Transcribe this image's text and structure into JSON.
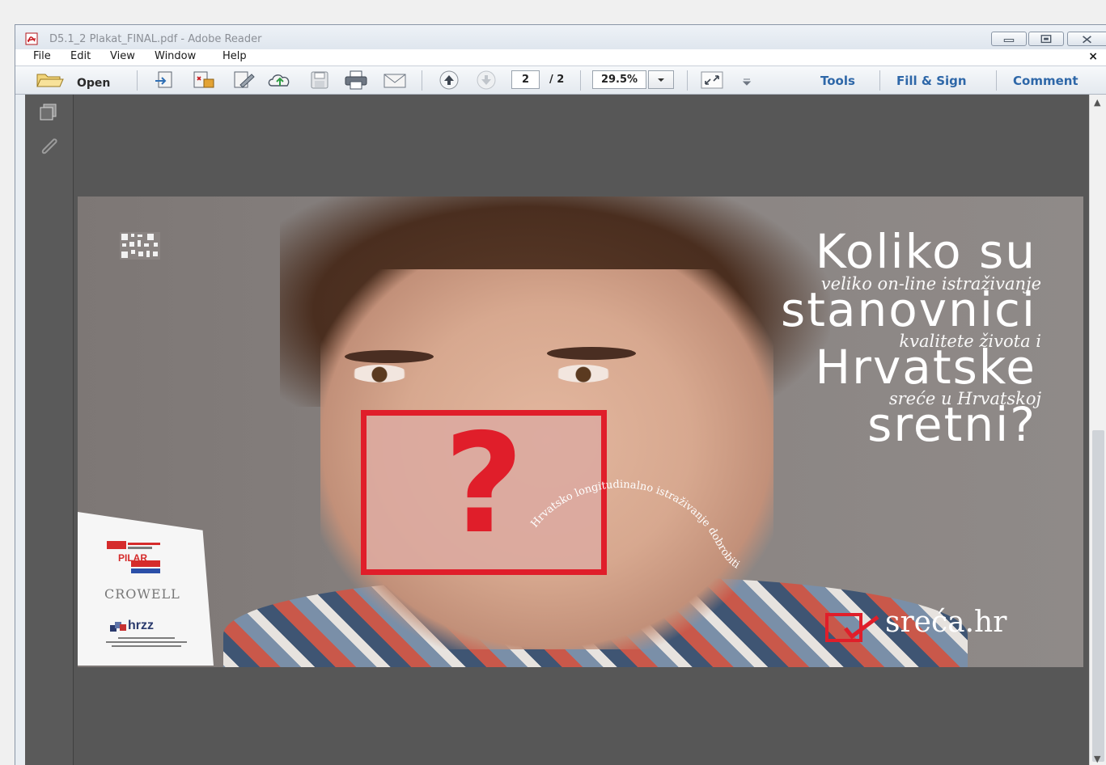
{
  "window": {
    "title": "D5.1_2 Plakat_FINAL.pdf - Adobe Reader"
  },
  "menu": {
    "items": [
      "File",
      "Edit",
      "View",
      "Window",
      "Help"
    ],
    "close_glyph": "×"
  },
  "toolbar": {
    "open_label": "Open",
    "page_current": "2",
    "page_total": "/ 2",
    "zoom_value": "29.5%",
    "tools_label": "Tools",
    "fill_sign_label": "Fill & Sign",
    "comment_label": "Comment"
  },
  "poster": {
    "headline_1": "Koliko su",
    "sub_1": "veliko on-line istraživanje",
    "headline_2": "stanovnici",
    "sub_2": "kvalitete života i",
    "headline_3": "Hrvatske",
    "sub_3": "sreće u Hrvatskoj",
    "headline_4": "sretni?",
    "question_mark": "?",
    "curved_text": "Hrvatsko longitudinalno istraživanje dobrobiti",
    "brand": "sreća.hr",
    "partner_1": "PILAR",
    "partner_2": "CROWELL",
    "partner_3": "hrzz"
  },
  "colors": {
    "accent_red": "#e01e2a",
    "link_blue": "#2e67a8",
    "viewer_bg": "#575757"
  }
}
